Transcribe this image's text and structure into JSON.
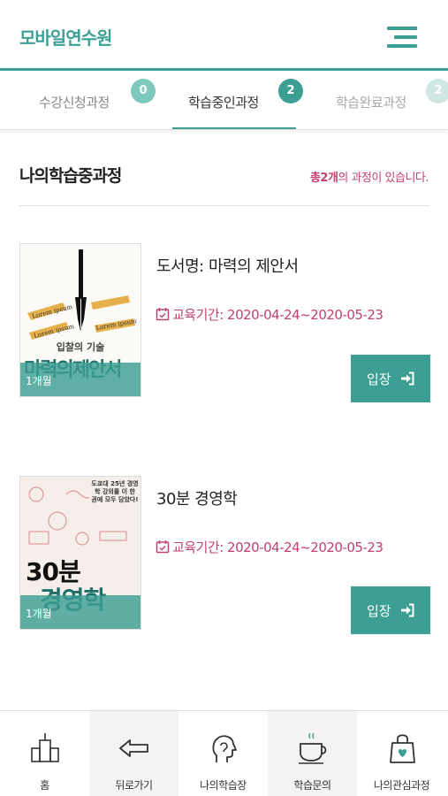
{
  "header": {
    "title": "모바일연수원",
    "menu_icon": "hamburger-menu-icon"
  },
  "tabs": [
    {
      "label": "수강신청과정",
      "count": "0",
      "active": false
    },
    {
      "label": "학습중인과정",
      "count": "2",
      "active": true
    },
    {
      "label": "학습완료과정",
      "count": "2",
      "active": false
    }
  ],
  "section": {
    "title": "나의학습중과정",
    "count_prefix": "총",
    "count_value": "2개",
    "count_suffix": "의 과정이 있습니다."
  },
  "courses": [
    {
      "title": "도서명: 마력의 제안서",
      "period_label": "교육기간:",
      "period": "2020-04-24~2020-05-23",
      "duration": "1개월",
      "enter_label": "입장",
      "cover_title": "마력의제안서",
      "cover_subtitle": "입찰의 기술"
    },
    {
      "title": "30분 경영학",
      "period_label": "교육기간:",
      "period": "2020-04-24~2020-05-23",
      "duration": "1개월",
      "enter_label": "입장",
      "cover_title": "30분",
      "cover_title_2": "경영학",
      "cover_blurb": "도쿄대 25년 경영학 강의를 이 한 권에 모두 담았다!"
    }
  ],
  "bottom_nav": [
    {
      "label": "홈",
      "icon": "home-icon"
    },
    {
      "label": "뒤로가기",
      "icon": "back-arrow-icon"
    },
    {
      "label": "나의학습장",
      "icon": "head-profile-icon"
    },
    {
      "label": "학습문의",
      "icon": "coffee-cup-icon"
    },
    {
      "label": "나의관심과정",
      "icon": "shopping-bag-icon"
    }
  ],
  "colors": {
    "accent": "#3d9f94",
    "highlight": "#c2406e"
  }
}
